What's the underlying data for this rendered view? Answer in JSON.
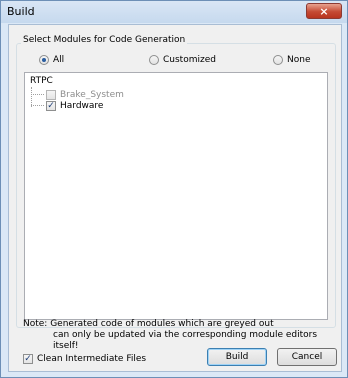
{
  "window": {
    "title": "Build",
    "close_glyph": "×"
  },
  "group": {
    "legend": "Select Modules for Code Generation",
    "radios": [
      {
        "label": "All",
        "checked": true
      },
      {
        "label": "Customized",
        "checked": false
      },
      {
        "label": "None",
        "checked": false
      }
    ]
  },
  "tree": {
    "root": "RTPC",
    "items": [
      {
        "label": "Brake_System",
        "checked": false,
        "greyed": true
      },
      {
        "label": "Hardware",
        "checked": true,
        "greyed": false
      }
    ]
  },
  "note": {
    "line1": "Note: Generated code of modules which are greyed out",
    "line2": "can only be updated via the corresponding module editors itself!"
  },
  "options": {
    "clean_label": "Clean Intermediate Files",
    "clean_checked": true
  },
  "buttons": {
    "build": "Build",
    "cancel": "Cancel"
  },
  "colors": {
    "radio_selected": "#2a5da0",
    "check_mark": "#1f3f78",
    "greyed_text": "#8d8d8d",
    "close_button": "#c54a34"
  }
}
